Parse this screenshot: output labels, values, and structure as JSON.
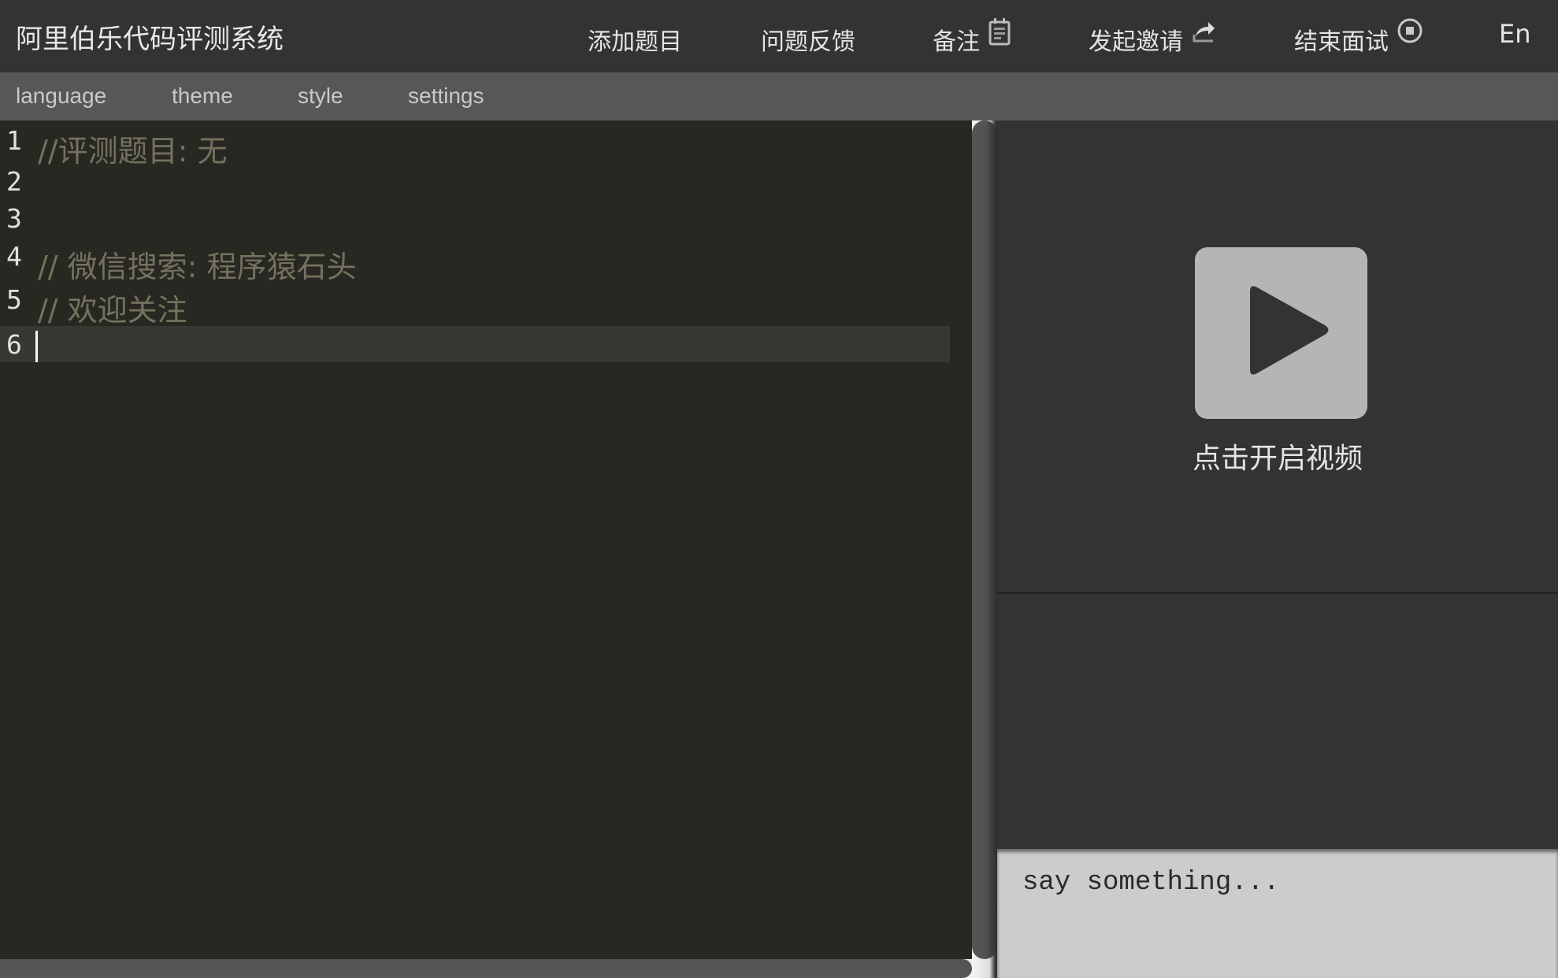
{
  "header": {
    "title": "阿里伯乐代码评测系统",
    "nav": [
      {
        "label": "添加题目",
        "icon": null
      },
      {
        "label": "问题反馈",
        "icon": null
      },
      {
        "label": "备注",
        "icon": "notepad-icon"
      },
      {
        "label": "发起邀请",
        "icon": "share-arrow-icon"
      },
      {
        "label": "结束面试",
        "icon": "stop-circle-icon"
      }
    ],
    "language_toggle": "En"
  },
  "menubar": {
    "items": [
      "language",
      "theme",
      "style",
      "settings"
    ]
  },
  "editor": {
    "lines": [
      {
        "number": "1",
        "code": "//评测题目: 无"
      },
      {
        "number": "2",
        "code": ""
      },
      {
        "number": "3",
        "code": ""
      },
      {
        "number": "4",
        "code": "// 微信搜索: 程序猿石头"
      },
      {
        "number": "5",
        "code": "// 欢迎关注"
      },
      {
        "number": "6",
        "code": ""
      }
    ],
    "active_line": 6,
    "colors": {
      "background": "#272822",
      "comment": "#75715e",
      "active_line": "#383832"
    }
  },
  "video": {
    "icon": "play-icon",
    "label": "点击开启视频"
  },
  "chat": {
    "input_placeholder": "say something...",
    "input_value": ""
  }
}
